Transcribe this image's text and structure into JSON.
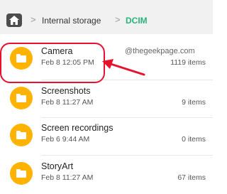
{
  "breadcrumb": {
    "items": [
      "Internal storage",
      "DCIM"
    ],
    "separator": ">"
  },
  "watermark": "@thegeekpage.com",
  "folders": [
    {
      "name": "Camera",
      "date": "Feb 8 12:05 PM",
      "count": "1119 items",
      "highlighted": true
    },
    {
      "name": "Screenshots",
      "date": "Feb 8 11:27 AM",
      "count": "9 items"
    },
    {
      "name": "Screen recordings",
      "date": "Feb 6 9:44 AM",
      "count": "0 items"
    },
    {
      "name": "StoryArt",
      "date": "Feb 8 11:27 AM",
      "count": "67 items"
    }
  ],
  "colors": {
    "folder": "#ffb300",
    "breadcrumb_current": "#2ab27b",
    "annotation": "#e8112d"
  },
  "icons": {
    "home": "home-icon",
    "folder": "folder-icon",
    "arrow": "annotation-arrow"
  }
}
